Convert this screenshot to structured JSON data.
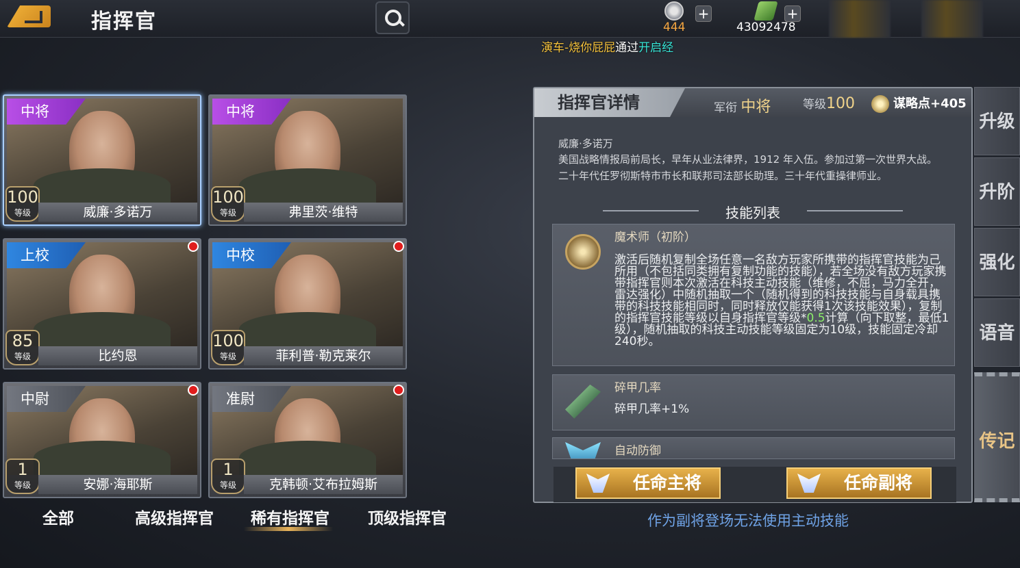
{
  "header": {
    "title": "指挥官",
    "medal_count": "444",
    "cash_count": "43092478",
    "ticker": {
      "name": "演车-烧你屁屁",
      "mid": "通过",
      "action": "开启经"
    }
  },
  "commanders": [
    {
      "rank": "中将",
      "rank_color": "purple",
      "level": "100",
      "level_label": "等级",
      "name": "威廉·多诺万",
      "selected": true,
      "dot": false
    },
    {
      "rank": "中将",
      "rank_color": "purple",
      "level": "100",
      "level_label": "等级",
      "name": "弗里茨·维特",
      "selected": false,
      "dot": false
    },
    {
      "rank": "上校",
      "rank_color": "blue",
      "level": "85",
      "level_label": "等级",
      "name": "比约恩",
      "selected": false,
      "dot": true
    },
    {
      "rank": "中校",
      "rank_color": "blue",
      "level": "100",
      "level_label": "等级",
      "name": "菲利普·勒克莱尔",
      "selected": false,
      "dot": true
    },
    {
      "rank": "中尉",
      "rank_color": "gray",
      "level": "1",
      "level_label": "等级",
      "name": "安娜·海耶斯",
      "selected": false,
      "dot": true
    },
    {
      "rank": "准尉",
      "rank_color": "gray",
      "level": "1",
      "level_label": "等级",
      "name": "克韩顿·艾布拉姆斯",
      "selected": false,
      "dot": true
    }
  ],
  "tabs": [
    "全部",
    "高级指挥官",
    "稀有指挥官",
    "顶级指挥官"
  ],
  "active_tab": "稀有指挥官",
  "detail": {
    "title": "指挥官详情",
    "rank_label": "军衔",
    "rank_value": "中将",
    "level_label": "等级",
    "level_value": "100",
    "strategy": "谋略点+405",
    "bio_name": "威廉·多诺万",
    "bio": "美国战略情报局前局长，早年从业法律界，1912 年入伍。参加过第一次世界大战。二十年代任罗彻斯特市市长和联邦司法部长助理。三十年代重操律师业。",
    "skills_title": "技能列表",
    "skills": [
      {
        "name": "魔术师（初阶）",
        "icon": "compass-icon",
        "desc_a": "激活后随机复制全场任意一名敌方玩家所携带的指挥官技能为己所用（不包括同类拥有复制功能的技能），若全场没有敌方玩家携带指挥官则本次激活在科技主动技能（维修，不屈，马力全开，雷达强化）中随机抽取一个（随机得到的科技技能与自身载具携带的科技技能相同时，同时释放仅能获得1次该技能效果），复制的指挥官技能等级以自身指挥官等级*",
        "desc_hl": "0.5",
        "desc_b": "计算（向下取整，最低1级），随机抽取的科技主动技能等级固定为10级，技能固定冷却240秒。"
      },
      {
        "name": "碎甲几率",
        "icon": "rifle-icon",
        "desc": "碎甲几率+1%"
      },
      {
        "name": "自动防御",
        "icon": "shield-icon"
      }
    ],
    "btn_main": "任命主将",
    "btn_sub": "任命副将",
    "note": "作为副将登场无法使用主动技能"
  },
  "side_tabs": [
    "升级",
    "升阶",
    "强化",
    "语音",
    "传记"
  ],
  "active_side_tab": "传记"
}
